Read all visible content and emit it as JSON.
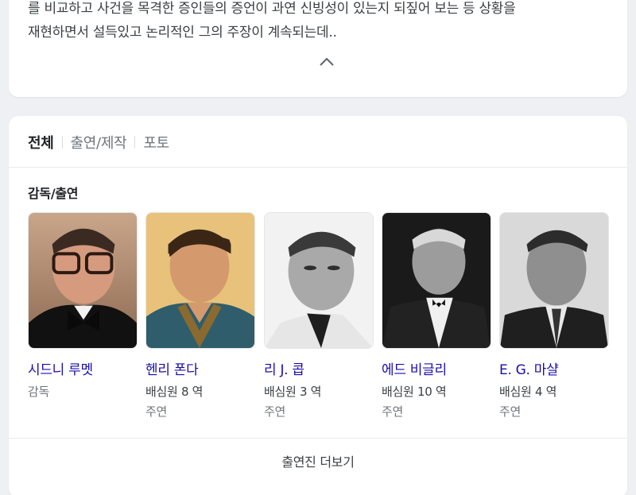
{
  "description": {
    "line1": "를 비교하고 사건을 목격한 증인들의 증언이 과연 신빙성이 있는지 되짚어 보는 등 상황을",
    "line2": "재현하면서 설득있고 논리적인 그의 주장이 계속되는데.."
  },
  "tabs": [
    {
      "label": "전체",
      "active": true
    },
    {
      "label": "출연/제작",
      "active": false
    },
    {
      "label": "포토",
      "active": false
    }
  ],
  "section_title": "감독/출연",
  "people": [
    {
      "name": "시드니 루멧",
      "role": "감독",
      "meta": ""
    },
    {
      "name": "헨리 폰다",
      "role": "배심원 8 역",
      "meta": "주연"
    },
    {
      "name": "리 J. 콥",
      "role": "배심원 3 역",
      "meta": "주연"
    },
    {
      "name": "에드 비글리",
      "role": "배심원 10 역",
      "meta": "주연"
    },
    {
      "name": "E. G. 마샬",
      "role": "배심원 4 역",
      "meta": "주연"
    }
  ],
  "more_label": "출연진 더보기",
  "colors": {
    "link": "#1a0dab",
    "muted": "#70757a",
    "background": "#eef0f3"
  }
}
